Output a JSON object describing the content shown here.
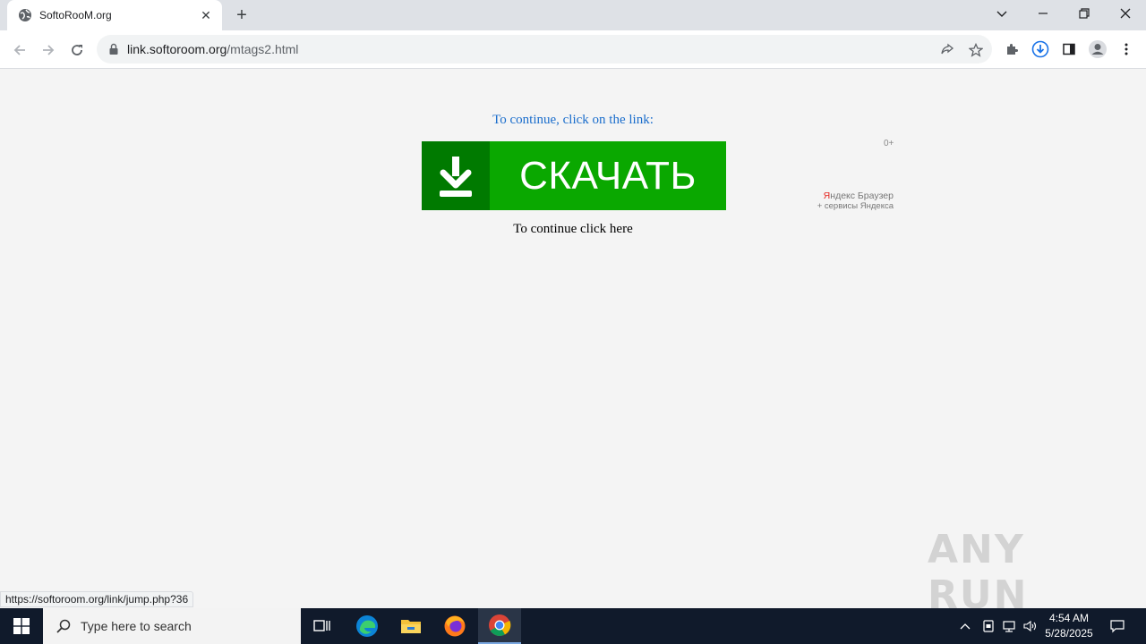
{
  "browser": {
    "tab": {
      "title": "SoftoRooM.org",
      "favicon": "globe-icon"
    },
    "url_host": "link.softoroom.org",
    "url_path": "/mtags2.html",
    "status_url": "https://softoroom.org/link/jump.php?36"
  },
  "page": {
    "continue_link_text": "To continue, click on the link:",
    "download_label": "СКАЧАТЬ",
    "age_rating": "0+",
    "ad_brand_first": "Я",
    "ad_brand_rest": "ндекс Браузер",
    "ad_sub": "+ сервисы Яндекса",
    "continue_here_text": "To continue click here",
    "colors": {
      "link": "#1a6dcc",
      "banner": "#0aa800",
      "banner_icon_bg": "#007a00"
    }
  },
  "taskbar": {
    "search_placeholder": "Type here to search",
    "time": "4:54 AM",
    "date": "5/28/2025"
  },
  "watermark": "ANY RUN"
}
